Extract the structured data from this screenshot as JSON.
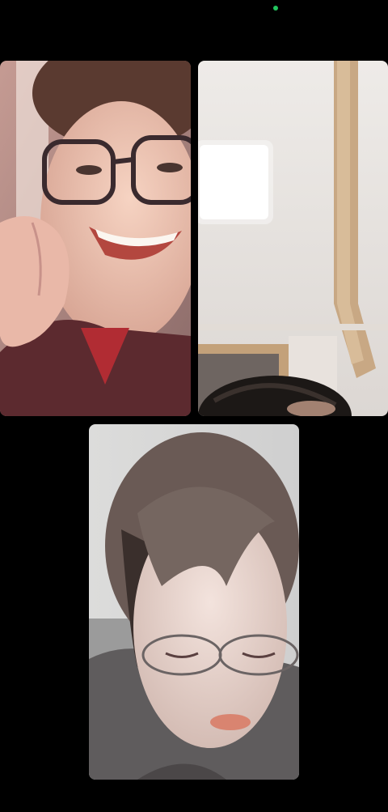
{
  "status": {
    "camera_indicator_color": "#22c55e"
  },
  "participants": [
    {
      "id": "participant-1",
      "icon": "video-feed"
    },
    {
      "id": "participant-2",
      "icon": "video-feed"
    },
    {
      "id": "participant-3",
      "icon": "video-feed"
    }
  ],
  "colors": {
    "background": "#000000",
    "wall_warm": "#b88f84",
    "ceiling": "#ece8e4",
    "room_gray": "#d6d3d1"
  }
}
